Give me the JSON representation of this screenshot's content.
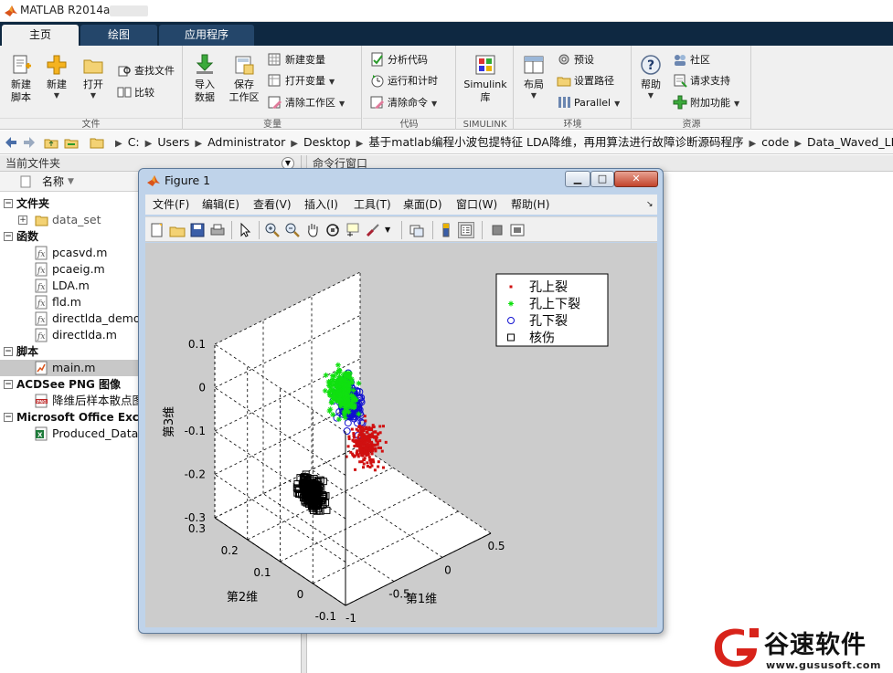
{
  "app": {
    "title": "MATLAB R2014a"
  },
  "ribbon": {
    "tabs": [
      "主页",
      "绘图",
      "应用程序"
    ],
    "file": {
      "label": "文件",
      "new_script": [
        "新建",
        "脚本"
      ],
      "new": "新建",
      "open": "打开",
      "find_files": "查找文件",
      "compare": "比较"
    },
    "variable": {
      "label": "变量",
      "import": [
        "导入",
        "数据"
      ],
      "save": [
        "保存",
        "工作区"
      ],
      "new_var": "新建变量",
      "open_var": "打开变量",
      "clear_ws": "清除工作区"
    },
    "code": {
      "label": "代码",
      "analyze": "分析代码",
      "run_time": "运行和计时",
      "clear_cmd": "清除命令"
    },
    "simulink": {
      "label": "SIMULINK",
      "lib": [
        "Simulink",
        "库"
      ]
    },
    "env": {
      "label": "环境",
      "layout": "布局",
      "prefs": "预设",
      "set_path": "设置路径",
      "parallel": "Parallel"
    },
    "resources": {
      "label": "资源",
      "help": "帮助",
      "community": "社区",
      "support": "请求支持",
      "addons": "附加功能"
    }
  },
  "addressbar": {
    "crumbs": [
      "C:",
      "Users",
      "Administrator",
      "Desktop",
      "基于matlab编程小波包提特征 LDA降维，再用算法进行故障诊断源码程序",
      "code",
      "Data_Waved_LDA"
    ]
  },
  "left_panel": {
    "title": "当前文件夹",
    "column": "名称",
    "groups": [
      {
        "name": "文件夹",
        "items": [
          "data_set"
        ]
      },
      {
        "name": "函数",
        "items": [
          "pcasvd.m",
          "pcaeig.m",
          "LDA.m",
          "fld.m",
          "directlda_demo.m",
          "directlda.m"
        ]
      },
      {
        "name": "脚本",
        "items": [
          "main.m"
        ]
      },
      {
        "name": "ACDSee PNG 图像",
        "items": [
          "降维后样本散点图.png"
        ]
      },
      {
        "name": "Microsoft Office Excel",
        "items": [
          "Produced_Data.xls"
        ]
      }
    ]
  },
  "cmd_window": {
    "title": "命令行窗口"
  },
  "figure": {
    "title": "Figure 1",
    "menus": [
      "文件(F)",
      "编辑(E)",
      "查看(V)",
      "插入(I)",
      "工具(T)",
      "桌面(D)",
      "窗口(W)",
      "帮助(H)"
    ]
  },
  "chart_data": {
    "type": "scatter",
    "title": "",
    "xlabel": "第1维",
    "ylabel": "第2维",
    "zlabel": "第3维",
    "xlim": [
      -1,
      0.5
    ],
    "ylim": [
      -0.1,
      0.3
    ],
    "zlim": [
      -0.3,
      0.1
    ],
    "xticks": [
      "-1",
      "-0.5",
      "0",
      "0.5"
    ],
    "yticks": [
      "-0.1",
      "0",
      "0.1",
      "0.2",
      "0.3"
    ],
    "zticks": [
      "-0.3",
      "-0.2",
      "-0.1",
      "0",
      "0.1"
    ],
    "grid": true,
    "legend_position": "top-right",
    "series": [
      {
        "name": "孔上裂",
        "marker": "dot",
        "color": "#d01010",
        "center": [
          0.05,
          0.15,
          -0.17
        ],
        "spread": [
          0.1,
          0.03,
          0.04
        ]
      },
      {
        "name": "孔上下裂",
        "marker": "star",
        "color": "#10e010",
        "center": [
          -0.1,
          0.18,
          -0.05
        ],
        "spread": [
          0.08,
          0.03,
          0.04
        ]
      },
      {
        "name": "孔下裂",
        "marker": "circle",
        "color": "#1010d0",
        "center": [
          0.05,
          0.2,
          -0.1
        ],
        "spread": [
          0.05,
          0.03,
          0.04
        ]
      },
      {
        "name": "核伤",
        "marker": "square",
        "color": "#000000",
        "center": [
          -0.6,
          0.12,
          -0.2
        ],
        "spread": [
          0.05,
          0.03,
          0.03
        ]
      }
    ]
  },
  "watermark": {
    "name": "谷速软件",
    "url": "www.gususoft.com"
  },
  "colors": {
    "ribbon_dark": "#0e2841",
    "ribbon_bg": "#f0f0f0",
    "figure_bg": "#cccccc",
    "window_frame": "#bfd3ea"
  }
}
